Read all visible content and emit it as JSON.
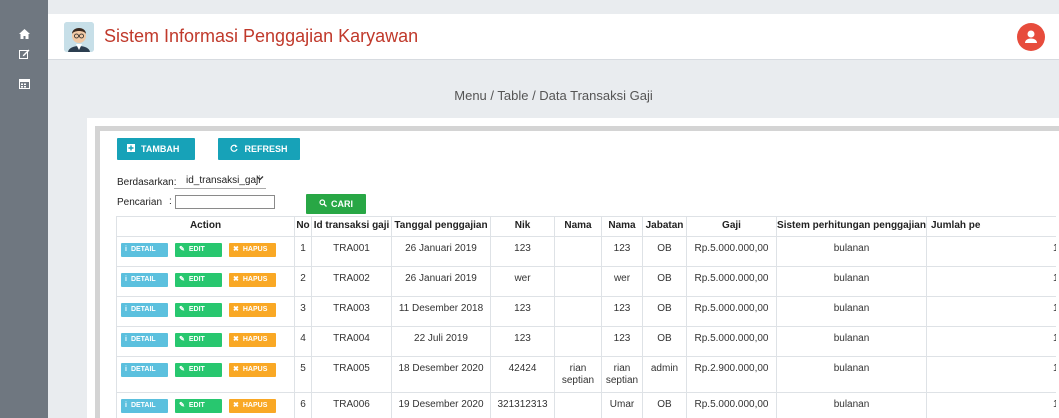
{
  "sidebar": {
    "icons": [
      {
        "name": "home-icon",
        "glyph": "⌂"
      },
      {
        "name": "edit-icon",
        "glyph": "✎"
      },
      {
        "name": "calendar-icon",
        "glyph": "▦"
      }
    ]
  },
  "header": {
    "title": "Sistem Informasi Penggajian Karyawan",
    "title_color": "#c0392b",
    "user_icon_color": "#e74c3c"
  },
  "breadcrumb": "Menu / Table / Data Transaksi Gaji",
  "toolbar": {
    "tambah_label": "TAMBAH",
    "refresh_label": "REFRESH",
    "button_color": "#17a2b8"
  },
  "filter": {
    "berdasarkan_label": "Berdasarkan:",
    "selected_field": "id_transaksi_gaji",
    "pencarian_label": "Pencarian",
    "pencarian_colon": ":",
    "search_value": "",
    "cari_label": "CARI",
    "cari_color": "#28a745"
  },
  "table": {
    "headers": [
      "Action",
      "No",
      "Id transaksi gaji",
      "Tanggal penggajian",
      "Nik",
      "Nama",
      "Nama",
      "Jabatan",
      "Gaji",
      "Sistem perhitungan penggajian",
      "Jumlah pe"
    ],
    "action_labels": {
      "detail": "DETAIL",
      "edit": "EDIT",
      "hapus": "HAPUS"
    },
    "rows": [
      [
        "1",
        "TRA001",
        "26 Januari 2019",
        "123",
        "",
        "123",
        "OB",
        "Rp.5.000.000,00",
        "bulanan",
        "1"
      ],
      [
        "2",
        "TRA002",
        "26 Januari 2019",
        "wer",
        "",
        "wer",
        "OB",
        "Rp.5.000.000,00",
        "bulanan",
        "1"
      ],
      [
        "3",
        "TRA003",
        "11 Desember 2018",
        "123",
        "",
        "123",
        "OB",
        "Rp.5.000.000,00",
        "bulanan",
        "1"
      ],
      [
        "4",
        "TRA004",
        "22 Juli 2019",
        "123",
        "",
        "123",
        "OB",
        "Rp.5.000.000,00",
        "bulanan",
        "1"
      ],
      [
        "5",
        "TRA005",
        "18 Desember 2020",
        "42424",
        "rian septian",
        "rian septian",
        "admin",
        "Rp.2.900.000,00",
        "bulanan",
        "1"
      ],
      [
        "6",
        "TRA006",
        "19 Desember 2020",
        "321312313",
        "",
        "Umar",
        "OB",
        "Rp.5.000.000,00",
        "bulanan",
        "1"
      ]
    ]
  }
}
